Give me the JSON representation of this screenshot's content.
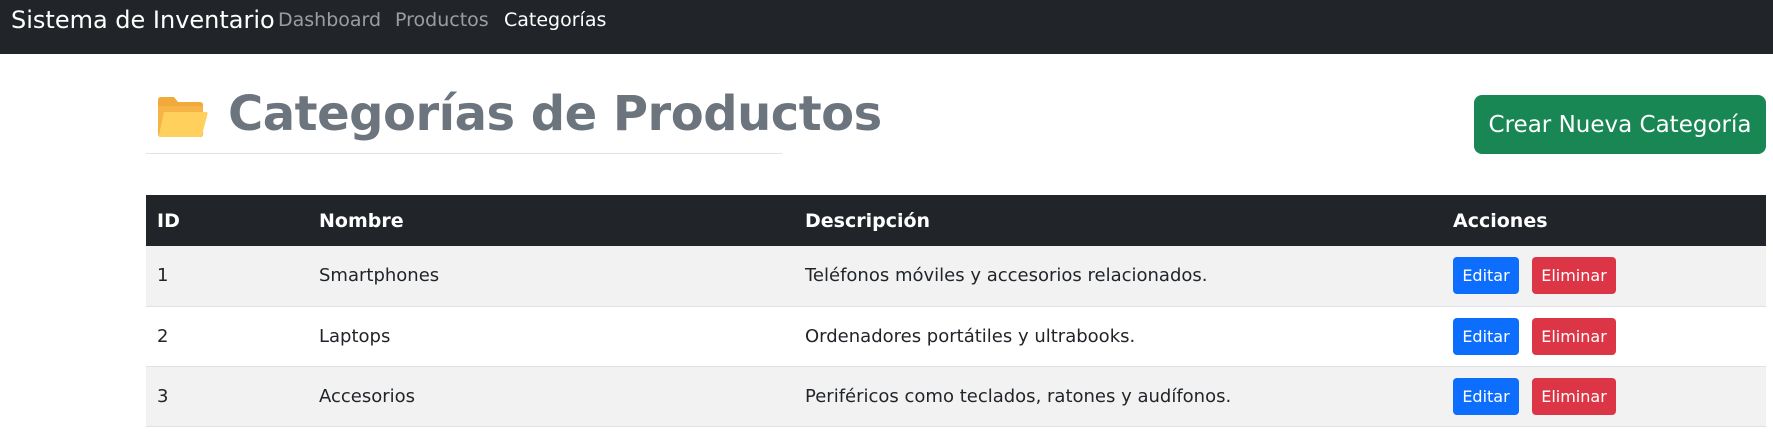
{
  "navbar": {
    "brand": "Sistema de Inventario",
    "links": [
      {
        "label": "Dashboard",
        "active": false
      },
      {
        "label": "Productos",
        "active": false
      },
      {
        "label": "Categorías",
        "active": true
      }
    ]
  },
  "header": {
    "icon": "open-folder-icon",
    "title": "Categorías de Productos",
    "create_button": "Crear Nueva Categoría"
  },
  "table": {
    "headers": [
      "ID",
      "Nombre",
      "Descripción",
      "Acciones"
    ],
    "rows": [
      {
        "id": "1",
        "name": "Smartphones",
        "description": "Teléfonos móviles y accesorios relacionados.",
        "edit": "Editar",
        "delete": "Eliminar"
      },
      {
        "id": "2",
        "name": "Laptops",
        "description": "Ordenadores portátiles y ultrabooks.",
        "edit": "Editar",
        "delete": "Eliminar"
      },
      {
        "id": "3",
        "name": "Accesorios",
        "description": "Periféricos como teclados, ratones y audífonos.",
        "edit": "Editar",
        "delete": "Eliminar"
      }
    ]
  },
  "colors": {
    "navbar_bg": "#212529",
    "title_gray": "#6c757d",
    "success": "#198754",
    "primary": "#0d6efd",
    "danger": "#dc3545"
  }
}
